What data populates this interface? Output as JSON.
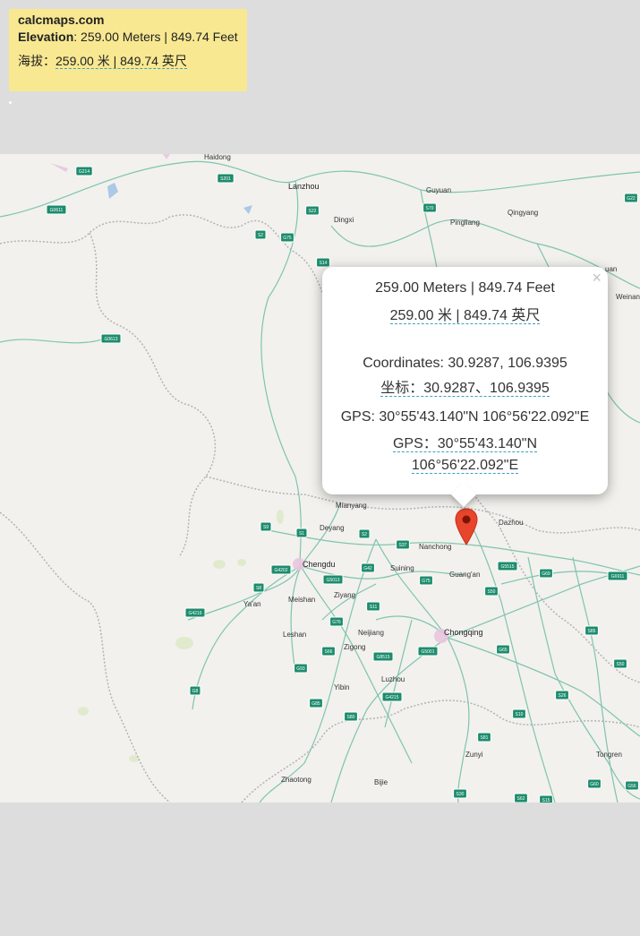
{
  "info": {
    "site": "calcmaps.com",
    "elevation_label": "Elevation",
    "elevation_value": ": 259.00 Meters | 849.74 Feet",
    "cn_prefix": "海拔：",
    "cn_value": "259.00 米 | 849.74 英尺"
  },
  "popup": {
    "close": "×",
    "elevation": "259.00 Meters | 849.74 Feet",
    "elevation_cn": "259.00 米 | 849.74 英尺",
    "coordinates": "Coordinates: 30.9287, 106.9395",
    "coordinates_cn_prefix": "坐标：",
    "coordinates_cn_value": "30.9287、106.9395",
    "gps": "GPS: 30°55'43.140\"N 106°56'22.092\"E",
    "gps_cn_prefix": "GPS：",
    "gps_cn_value1": "30°55'43.140\"N",
    "gps_cn_value2": "106°56'22.092\"E"
  },
  "map": {
    "cities": {
      "haidong": "Haidong",
      "lanzhou": "Lanzhou",
      "dingxi": "Dingxi",
      "guyuan": "Guyuan",
      "pingliang": "Pingliang",
      "qingyang": "Qingyang",
      "huan": "uan",
      "weinan": "Weinan",
      "mianyang": "Mianyang",
      "deyang": "Deyang",
      "dazhou": "Dazhou",
      "nanchong": "Nanchong",
      "chengdu": "Chengdu",
      "suining": "Suining",
      "guangan": "Guang'an",
      "meishan": "Meishan",
      "ziyang": "Ziyang",
      "yaan": "Ya'an",
      "leshan": "Leshan",
      "neijiang": "Neijiang",
      "chongqing": "Chongqing",
      "zigong": "Zigong",
      "luzhou": "Luzhou",
      "yibin": "Yibin",
      "zunyi": "Zunyi",
      "tongren": "Tongren",
      "zhaotong": "Zhaotong",
      "bijie": "Bijie"
    },
    "shields": {
      "s0": "G214",
      "s1": "S201",
      "s2": "G0611",
      "s3": "S22",
      "s4": "S2",
      "s5": "G75",
      "s6": "S14",
      "s7": "G0613",
      "s8": "S70",
      "s9": "G22",
      "s10": "S9",
      "s11": "S1",
      "s12": "S2",
      "s13": "S37",
      "s14": "G4202",
      "s15": "G5013",
      "s16": "G42",
      "s17": "G5515",
      "s18": "G69",
      "s19": "G6911",
      "s20": "S8",
      "s21": "G75",
      "s22": "S50",
      "s23": "G4216",
      "s24": "S11",
      "s25": "G76",
      "s26": "G8515",
      "s27": "S66",
      "s28": "G5001",
      "s29": "G65",
      "s30": "S85",
      "s31": "G93",
      "s32": "G85",
      "s33": "G4215",
      "s34": "S80",
      "s35": "S10",
      "s36": "S26",
      "s37": "S81",
      "s38": "G8",
      "s39": "S30",
      "s40": "S62",
      "s41": "G60",
      "s42": "G56",
      "s43": "S50",
      "s44": "S15"
    }
  },
  "colors": {
    "banner": "#f8e891",
    "map_land": "#f2f1ed",
    "road": "#7fc4ac",
    "highway_shield": "#1d8c6d",
    "marker": "#e8452c",
    "page_bg": "#dddddd"
  }
}
